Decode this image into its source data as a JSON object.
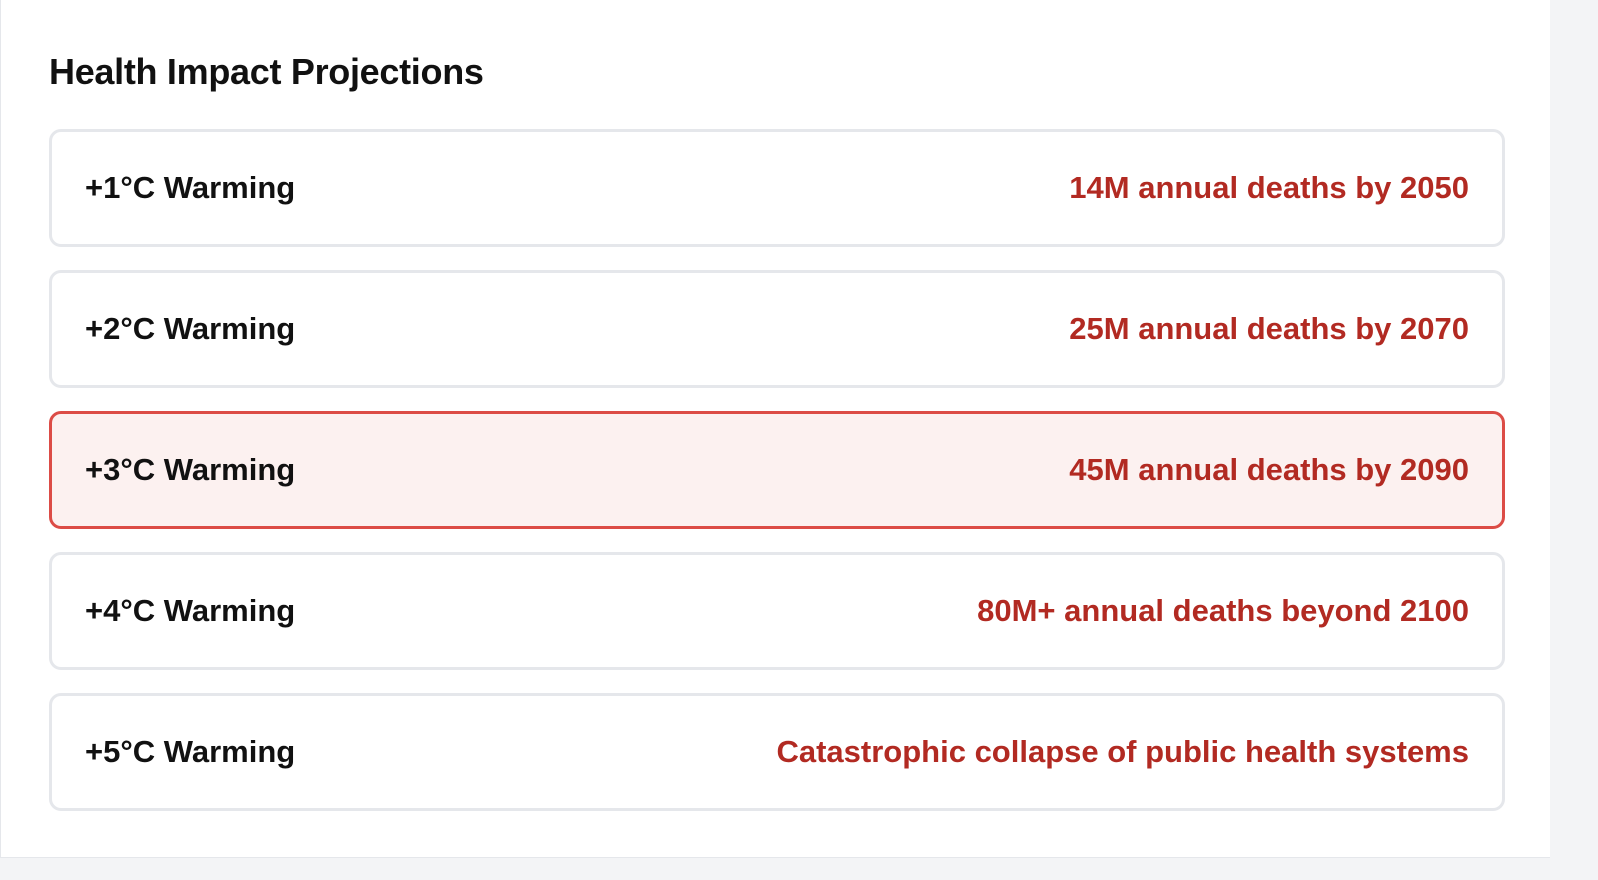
{
  "section": {
    "title": "Health Impact Projections"
  },
  "projections": [
    {
      "label": "+1°C Warming",
      "value": "14M annual deaths by 2050",
      "highlighted": false
    },
    {
      "label": "+2°C Warming",
      "value": "25M annual deaths by 2070",
      "highlighted": false
    },
    {
      "label": "+3°C Warming",
      "value": "45M annual deaths by 2090",
      "highlighted": true
    },
    {
      "label": "+4°C Warming",
      "value": "80M+ annual deaths beyond 2100",
      "highlighted": false
    },
    {
      "label": "+5°C Warming",
      "value": "Catastrophic collapse of public health systems",
      "highlighted": false
    }
  ],
  "colors": {
    "value_text": "#b22a22",
    "highlight_border": "#dc4c46",
    "highlight_background": "#fcf1f0",
    "row_border": "#e5e7eb"
  }
}
